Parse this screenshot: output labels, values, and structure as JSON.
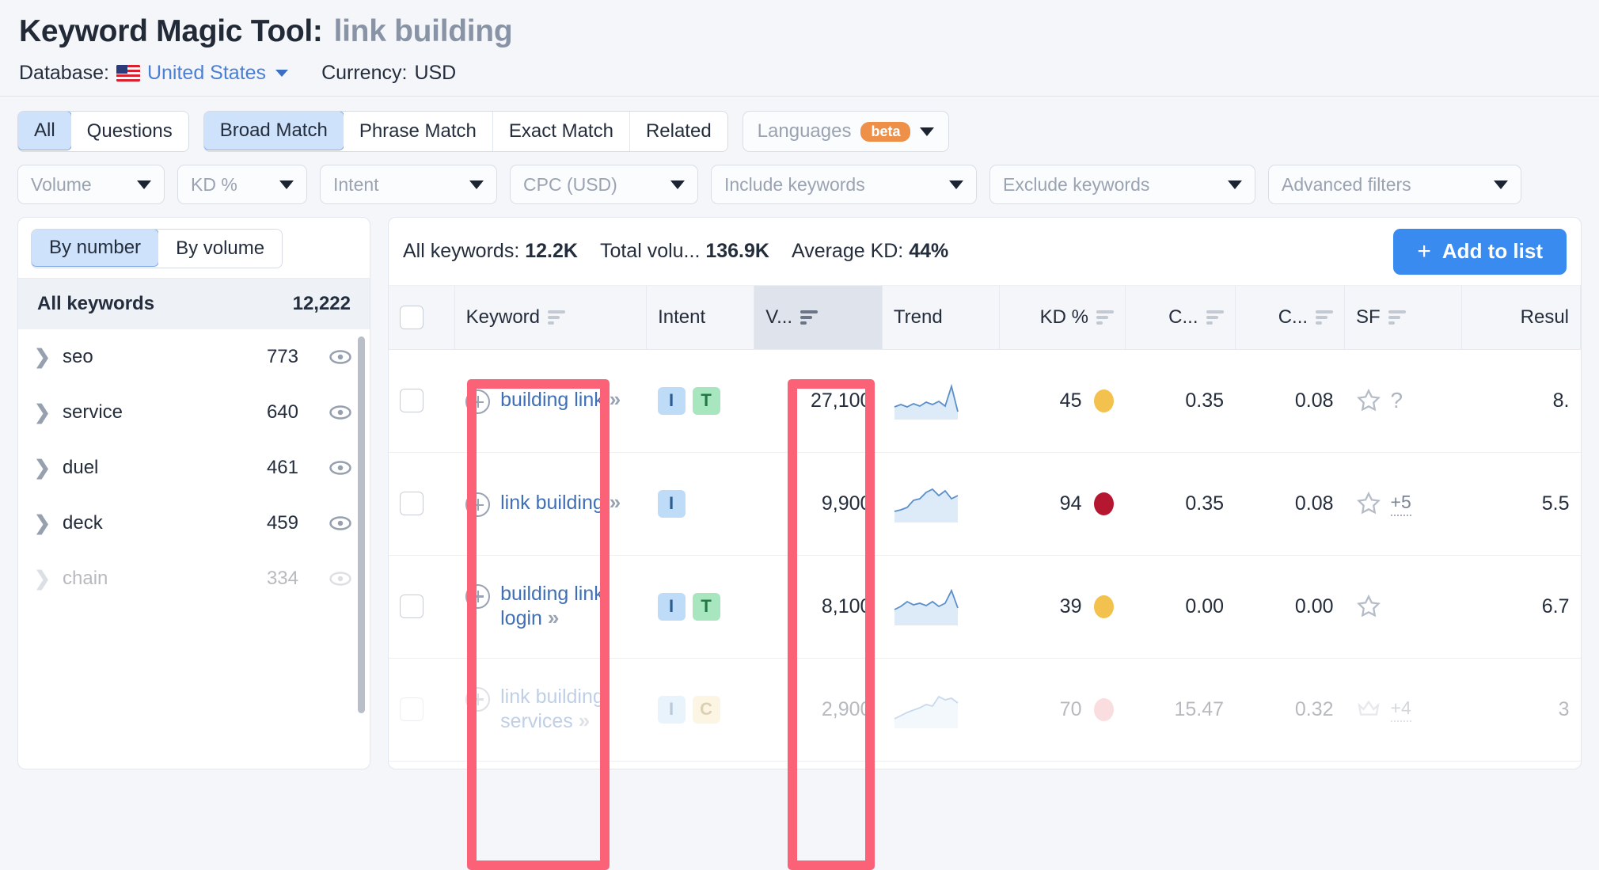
{
  "header": {
    "title_label": "Keyword Magic Tool:",
    "query": "link building",
    "database_label": "Database:",
    "database_value": "United States",
    "currency_label": "Currency:",
    "currency_value": "USD",
    "flag_icon": "us-flag-icon",
    "chevron_icon": "chevron-down-icon"
  },
  "filters": {
    "question_tabs": [
      {
        "label": "All",
        "active": true
      },
      {
        "label": "Questions",
        "active": false
      }
    ],
    "match_tabs": [
      {
        "label": "Broad Match",
        "active": true
      },
      {
        "label": "Phrase Match",
        "active": false
      },
      {
        "label": "Exact Match",
        "active": false
      },
      {
        "label": "Related",
        "active": false
      }
    ],
    "languages": {
      "label": "Languages",
      "badge": "beta",
      "icon": "chevron-down-icon"
    },
    "dropdowns": [
      {
        "label": "Volume"
      },
      {
        "label": "KD %"
      },
      {
        "label": "Intent"
      },
      {
        "label": "CPC (USD)"
      },
      {
        "label": "Include keywords"
      },
      {
        "label": "Exclude keywords"
      },
      {
        "label": "Advanced filters"
      }
    ]
  },
  "sidebar": {
    "toggle": [
      {
        "label": "By number",
        "active": true
      },
      {
        "label": "By volume",
        "active": false
      }
    ],
    "all_keywords_label": "All keywords",
    "all_keywords_count": "12,222",
    "groups": [
      {
        "name": "seo",
        "count": "773",
        "faded": false
      },
      {
        "name": "service",
        "count": "640",
        "faded": false
      },
      {
        "name": "duel",
        "count": "461",
        "faded": false
      },
      {
        "name": "deck",
        "count": "459",
        "faded": false
      },
      {
        "name": "chain",
        "count": "334",
        "faded": true
      }
    ],
    "expand_icon": "chevron-right-icon",
    "visibility_icon": "eye-icon"
  },
  "summary": {
    "all_keywords_label": "All keywords:",
    "all_keywords_value": "12.2K",
    "total_volume_label": "Total volu...",
    "total_volume_value": "136.9K",
    "average_kd_label": "Average KD:",
    "average_kd_value": "44%",
    "add_to_list_label": "Add to list",
    "add_icon": "plus-icon"
  },
  "table": {
    "columns": [
      {
        "key": "check",
        "label": "",
        "align": "left",
        "sorted": false,
        "sortable": false
      },
      {
        "key": "keyword",
        "label": "Keyword",
        "align": "left",
        "sorted": false,
        "sortable": true
      },
      {
        "key": "intent",
        "label": "Intent",
        "align": "left",
        "sorted": false,
        "sortable": false
      },
      {
        "key": "volume",
        "label": "V...",
        "align": "left",
        "sorted": true,
        "sortable": true
      },
      {
        "key": "trend",
        "label": "Trend",
        "align": "left",
        "sorted": false,
        "sortable": false
      },
      {
        "key": "kd",
        "label": "KD %",
        "align": "right",
        "sorted": false,
        "sortable": true
      },
      {
        "key": "cpc",
        "label": "C...",
        "align": "right",
        "sorted": false,
        "sortable": true
      },
      {
        "key": "com",
        "label": "C...",
        "align": "right",
        "sorted": false,
        "sortable": true
      },
      {
        "key": "sf",
        "label": "SF",
        "align": "left",
        "sorted": false,
        "sortable": true
      },
      {
        "key": "results",
        "label": "Resul",
        "align": "right",
        "sorted": false,
        "sortable": false
      }
    ],
    "rows": [
      {
        "keyword": "building link",
        "intent": [
          "I",
          "T"
        ],
        "volume": "27,100",
        "kd": "45",
        "kd_color": "#f2c14e",
        "cpc": "0.35",
        "com": "0.08",
        "sf_star": "star-outline-icon",
        "sf_extra": "?",
        "results": "8.",
        "faded": false,
        "trend": [
          10,
          9,
          11,
          8,
          9,
          7,
          10,
          9,
          6,
          14,
          2
        ]
      },
      {
        "keyword": "link building",
        "intent": [
          "I"
        ],
        "volume": "9,900",
        "kd": "94",
        "kd_color": "#b51630",
        "cpc": "0.35",
        "com": "0.08",
        "sf_star": "star-outline-icon",
        "sf_extra": "+5",
        "results": "5.5",
        "faded": false,
        "trend": [
          14,
          12,
          11,
          9,
          8,
          6,
          7,
          5,
          2,
          4,
          6
        ]
      },
      {
        "keyword": "building link login",
        "intent": [
          "I",
          "T"
        ],
        "volume": "8,100",
        "kd": "39",
        "kd_color": "#f2c14e",
        "cpc": "0.00",
        "com": "0.00",
        "sf_star": "star-outline-icon",
        "sf_extra": "",
        "results": "6.7",
        "faded": false,
        "trend": [
          12,
          9,
          10,
          8,
          9,
          10,
          9,
          11,
          8,
          2,
          9
        ]
      },
      {
        "keyword": "link building services",
        "intent": [
          "I",
          "C"
        ],
        "volume": "2,900",
        "kd": "70",
        "kd_color": "#f09a9d",
        "cpc": "15.47",
        "com": "0.32",
        "sf_star": "crown-icon",
        "sf_extra": "+4",
        "results": "3",
        "faded": true,
        "trend": [
          13,
          12,
          10,
          9,
          8,
          6,
          7,
          4,
          2,
          3,
          5
        ]
      }
    ]
  },
  "annotations": [
    {
      "name": "keyword-column-highlight",
      "color": "#fb6277"
    },
    {
      "name": "volume-column-highlight",
      "color": "#fb6277"
    }
  ]
}
